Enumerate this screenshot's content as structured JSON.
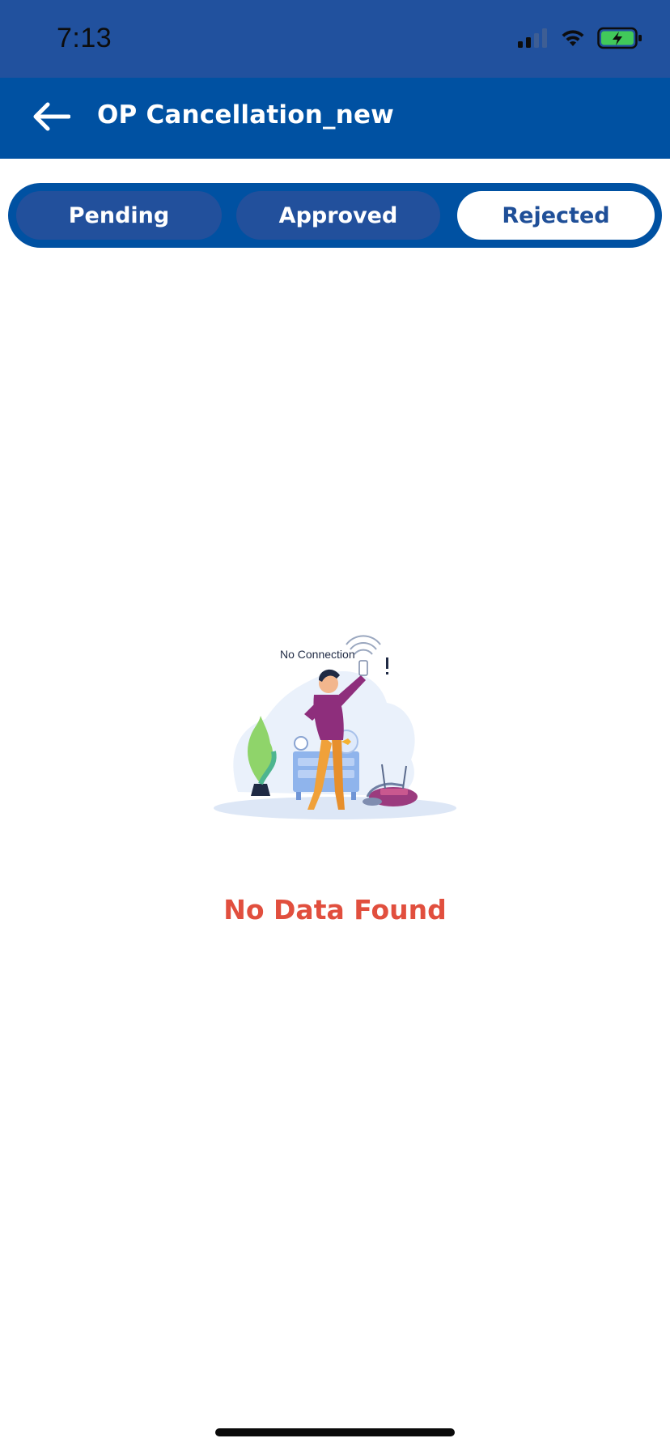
{
  "status_bar": {
    "time": "7:13"
  },
  "header": {
    "title": "OP Cancellation_new",
    "back_icon": "arrow-left-icon"
  },
  "tabs": [
    {
      "label": "Pending",
      "active": false
    },
    {
      "label": "Approved",
      "active": false
    },
    {
      "label": "Rejected",
      "active": true
    }
  ],
  "illustration": {
    "caption": "No Connection"
  },
  "empty_state": {
    "message": "No Data Found"
  },
  "colors": {
    "status_bar": "#21519e",
    "app_bar": "#0051a2",
    "tab_inactive": "#22509c",
    "tab_active_text": "#1f4f98",
    "empty_text": "#e14f3e"
  }
}
